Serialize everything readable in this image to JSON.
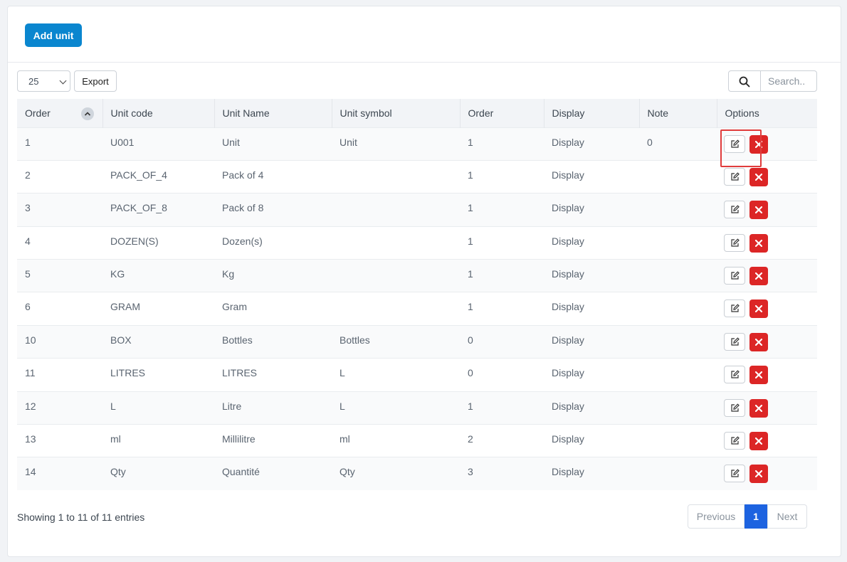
{
  "header": {
    "add_button": "Add unit"
  },
  "toolbar": {
    "page_size": "25",
    "export_label": "Export",
    "search_placeholder": "Search.."
  },
  "table": {
    "columns": [
      "Order",
      "Unit code",
      "Unit Name",
      "Unit symbol",
      "Order",
      "Display",
      "Note",
      "Options"
    ],
    "rows": [
      [
        "1",
        "U001",
        "Unit",
        "Unit",
        "1",
        "Display",
        "0"
      ],
      [
        "2",
        "PACK_OF_4",
        "Pack of 4",
        "",
        "1",
        "Display",
        ""
      ],
      [
        "3",
        "PACK_OF_8",
        "Pack of 8",
        "",
        "1",
        "Display",
        ""
      ],
      [
        "4",
        "DOZEN(S)",
        "Dozen(s)",
        "",
        "1",
        "Display",
        ""
      ],
      [
        "5",
        "KG",
        "Kg",
        "",
        "1",
        "Display",
        ""
      ],
      [
        "6",
        "GRAM",
        "Gram",
        "",
        "1",
        "Display",
        ""
      ],
      [
        "10",
        "BOX",
        "Bottles",
        "Bottles",
        "0",
        "Display",
        ""
      ],
      [
        "11",
        "LITRES",
        "LITRES",
        "L",
        "0",
        "Display",
        ""
      ],
      [
        "12",
        "L",
        "Litre",
        "L",
        "1",
        "Display",
        ""
      ],
      [
        "13",
        "ml",
        "Millilitre",
        "ml",
        "2",
        "Display",
        ""
      ],
      [
        "14",
        "Qty",
        "Quantité",
        "Qty",
        "3",
        "Display",
        ""
      ]
    ]
  },
  "footer": {
    "info": "Showing 1 to 11 of 11 entries"
  },
  "pagination": {
    "previous": "Previous",
    "current": "1",
    "next": "Next"
  },
  "icons": {
    "sort": "chevron-up-icon",
    "search": "search-icon",
    "edit": "edit-icon",
    "delete": "close-icon"
  },
  "colors": {
    "primary": "#0a86cf",
    "danger": "#dc2626",
    "page_active": "#1d63e0",
    "highlight": "#e03c3c"
  }
}
